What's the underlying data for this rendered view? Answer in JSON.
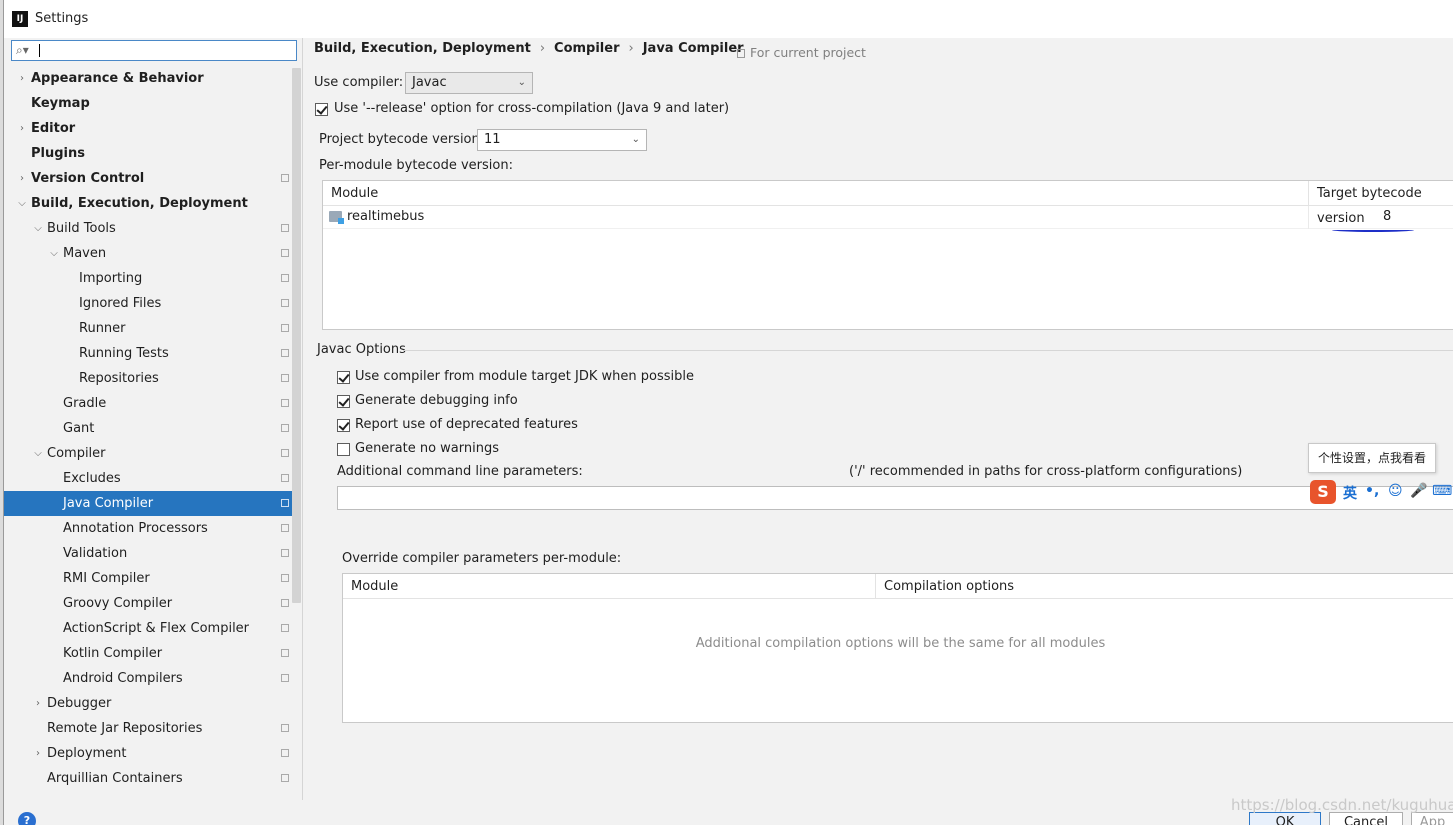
{
  "window": {
    "title": "Settings",
    "app_icon": "IJ"
  },
  "search": {
    "value": ""
  },
  "sidebar": {
    "items": [
      {
        "label": "Appearance & Behavior",
        "arrow": "right",
        "bold": true,
        "copy": false,
        "level": 0,
        "selected": false
      },
      {
        "label": "Keymap",
        "arrow": "",
        "bold": true,
        "copy": false,
        "level": 0,
        "selected": false
      },
      {
        "label": "Editor",
        "arrow": "right",
        "bold": true,
        "copy": false,
        "level": 0,
        "selected": false
      },
      {
        "label": "Plugins",
        "arrow": "",
        "bold": true,
        "copy": false,
        "level": 0,
        "selected": false
      },
      {
        "label": "Version Control",
        "arrow": "right",
        "bold": true,
        "copy": true,
        "level": 0,
        "selected": false
      },
      {
        "label": "Build, Execution, Deployment",
        "arrow": "down",
        "bold": true,
        "copy": false,
        "level": 0,
        "selected": false
      },
      {
        "label": "Build Tools",
        "arrow": "down",
        "bold": false,
        "copy": true,
        "level": 1,
        "selected": false
      },
      {
        "label": "Maven",
        "arrow": "down",
        "bold": false,
        "copy": true,
        "level": 2,
        "selected": false
      },
      {
        "label": "Importing",
        "arrow": "",
        "bold": false,
        "copy": true,
        "level": 3,
        "selected": false
      },
      {
        "label": "Ignored Files",
        "arrow": "",
        "bold": false,
        "copy": true,
        "level": 3,
        "selected": false
      },
      {
        "label": "Runner",
        "arrow": "",
        "bold": false,
        "copy": true,
        "level": 3,
        "selected": false
      },
      {
        "label": "Running Tests",
        "arrow": "",
        "bold": false,
        "copy": true,
        "level": 3,
        "selected": false
      },
      {
        "label": "Repositories",
        "arrow": "",
        "bold": false,
        "copy": true,
        "level": 3,
        "selected": false
      },
      {
        "label": "Gradle",
        "arrow": "",
        "bold": false,
        "copy": true,
        "level": 2,
        "selected": false
      },
      {
        "label": "Gant",
        "arrow": "",
        "bold": false,
        "copy": true,
        "level": 2,
        "selected": false
      },
      {
        "label": "Compiler",
        "arrow": "down",
        "bold": false,
        "copy": true,
        "level": 1,
        "selected": false
      },
      {
        "label": "Excludes",
        "arrow": "",
        "bold": false,
        "copy": true,
        "level": 2,
        "selected": false
      },
      {
        "label": "Java Compiler",
        "arrow": "",
        "bold": false,
        "copy": true,
        "level": 2,
        "selected": true
      },
      {
        "label": "Annotation Processors",
        "arrow": "",
        "bold": false,
        "copy": true,
        "level": 2,
        "selected": false
      },
      {
        "label": "Validation",
        "arrow": "",
        "bold": false,
        "copy": true,
        "level": 2,
        "selected": false
      },
      {
        "label": "RMI Compiler",
        "arrow": "",
        "bold": false,
        "copy": true,
        "level": 2,
        "selected": false
      },
      {
        "label": "Groovy Compiler",
        "arrow": "",
        "bold": false,
        "copy": true,
        "level": 2,
        "selected": false
      },
      {
        "label": "ActionScript & Flex Compiler",
        "arrow": "",
        "bold": false,
        "copy": true,
        "level": 2,
        "selected": false
      },
      {
        "label": "Kotlin Compiler",
        "arrow": "",
        "bold": false,
        "copy": true,
        "level": 2,
        "selected": false
      },
      {
        "label": "Android Compilers",
        "arrow": "",
        "bold": false,
        "copy": true,
        "level": 2,
        "selected": false
      },
      {
        "label": "Debugger",
        "arrow": "right",
        "bold": false,
        "copy": false,
        "level": 1,
        "selected": false
      },
      {
        "label": "Remote Jar Repositories",
        "arrow": "",
        "bold": false,
        "copy": true,
        "level": 1,
        "selected": false
      },
      {
        "label": "Deployment",
        "arrow": "right",
        "bold": false,
        "copy": true,
        "level": 1,
        "selected": false
      },
      {
        "label": "Arquillian Containers",
        "arrow": "",
        "bold": false,
        "copy": true,
        "level": 1,
        "selected": false
      }
    ]
  },
  "breadcrumb": [
    "Build, Execution, Deployment",
    "Compiler",
    "Java Compiler"
  ],
  "for_current_project": "For current project",
  "form": {
    "use_compiler_label": "Use compiler:",
    "use_compiler_value": "Javac",
    "release_option_label": "Use '--release' option for cross-compilation (Java 9 and later)",
    "release_option_checked": true,
    "project_bytecode_label": "Project bytecode version:",
    "project_bytecode_value": "11",
    "per_module_label": "Per-module bytecode version:"
  },
  "module_table": {
    "col_module": "Module",
    "col_target": "Target bytecode version",
    "rows": [
      {
        "module": "realtimebus",
        "target": "8"
      }
    ]
  },
  "javac": {
    "section_title": "Javac Options",
    "options": [
      {
        "label": "Use compiler from module target JDK when possible",
        "checked": true
      },
      {
        "label": "Generate debugging info",
        "checked": true
      },
      {
        "label": "Report use of deprecated features",
        "checked": true
      },
      {
        "label": "Generate no warnings",
        "checked": false
      }
    ],
    "additional_label": "Additional command line parameters:",
    "additional_hint": "('/' recommended in paths for cross-platform configurations)",
    "additional_value": ""
  },
  "override_table": {
    "label": "Override compiler parameters per-module:",
    "col_module": "Module",
    "col_options": "Compilation options",
    "empty_text": "Additional compilation options will be the same for all modules"
  },
  "ime": {
    "tooltip": "个性设置，点我看看",
    "logo": "S",
    "lang": "英",
    "punct": "•,",
    "emoji": "☺",
    "mic": "🎤",
    "keyboard": "⌨"
  },
  "buttons": {
    "ok": "OK",
    "cancel": "Cancel",
    "apply": "App"
  },
  "watermark": "https://blog.csdn.net/kuguhuan",
  "colors": {
    "selection": "#2675bf",
    "accent": "#4a88c7"
  }
}
